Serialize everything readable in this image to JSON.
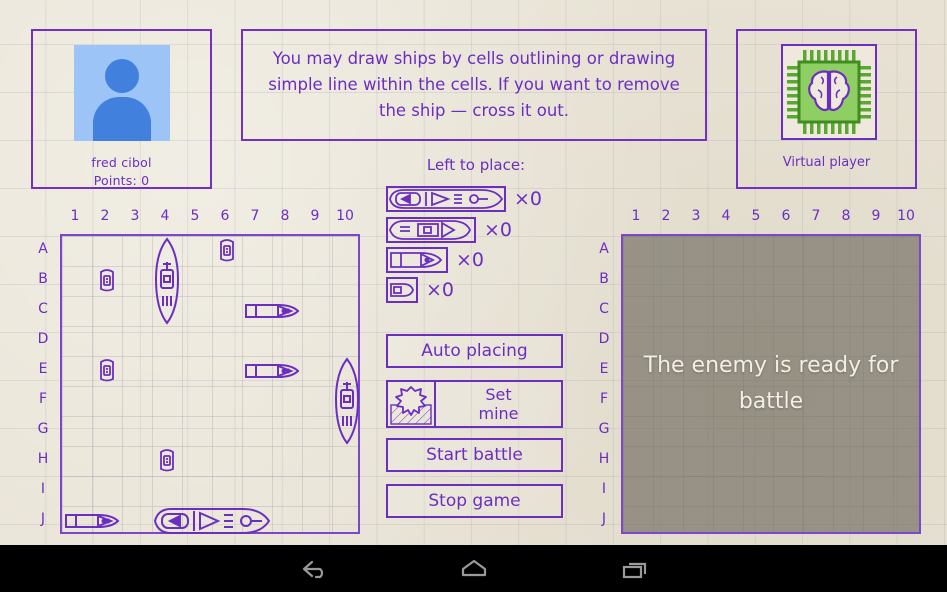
{
  "player": {
    "name": "fred cibol",
    "points_label": "Points: 0",
    "avatar_icon": "person-avatar-icon",
    "avatar_bg": "#9cc4f7",
    "avatar_fg": "#4180dd"
  },
  "instruction": {
    "text": "You may draw ships by cells outlining or drawing simple line within the cells. If you want to remove the ship — cross it out."
  },
  "opponent": {
    "label": "Virtual player",
    "avatar_icon": "cpu-brain-icon",
    "chip_color": "#5aa832",
    "brain_color": "#6b2fc0"
  },
  "theme": {
    "ink": "#6b2fc0",
    "ink_light": "#7d47c9",
    "paper": "#e9e4d6",
    "overlay": "rgba(105,100,88,0.62)",
    "overlay_text": "#f2efe6"
  },
  "fleet": {
    "title": "Left to place:",
    "rows": [
      {
        "size": 4,
        "count_label": "×0",
        "count": 0,
        "icon": "ship-4-icon"
      },
      {
        "size": 3,
        "count_label": "×0",
        "count": 0,
        "icon": "ship-3-icon"
      },
      {
        "size": 2,
        "count_label": "×0",
        "count": 0,
        "icon": "ship-2-icon"
      },
      {
        "size": 1,
        "count_label": "×0",
        "count": 0,
        "icon": "ship-1-icon"
      }
    ]
  },
  "buttons": {
    "auto_placing": "Auto placing",
    "set_mine": "Set\nmine",
    "set_mine_line1": "Set",
    "set_mine_line2": "mine",
    "start_battle": "Start battle",
    "stop_game": "Stop game"
  },
  "boards": {
    "col_labels": [
      "1",
      "2",
      "3",
      "4",
      "5",
      "6",
      "7",
      "8",
      "9",
      "10"
    ],
    "row_labels": [
      "A",
      "B",
      "C",
      "D",
      "E",
      "F",
      "G",
      "H",
      "I",
      "J"
    ],
    "player": {
      "title": "player-board",
      "ships": [
        {
          "size": 3,
          "orientation": "vertical",
          "col": 4,
          "row": "A",
          "cells": [
            "A4",
            "B4",
            "C4"
          ]
        },
        {
          "size": 1,
          "orientation": "single",
          "col": 6,
          "row": "A",
          "cells": [
            "A6"
          ]
        },
        {
          "size": 1,
          "orientation": "single",
          "col": 2,
          "row": "B",
          "cells": [
            "B2"
          ]
        },
        {
          "size": 2,
          "orientation": "horizontal",
          "col": 7,
          "row": "C",
          "cells": [
            "C7",
            "C8"
          ]
        },
        {
          "size": 1,
          "orientation": "single",
          "col": 2,
          "row": "E",
          "cells": [
            "E2"
          ]
        },
        {
          "size": 2,
          "orientation": "horizontal",
          "col": 7,
          "row": "E",
          "cells": [
            "E7",
            "E8"
          ]
        },
        {
          "size": 3,
          "orientation": "vertical",
          "col": 10,
          "row": "E",
          "cells": [
            "E10",
            "F10",
            "G10"
          ]
        },
        {
          "size": 1,
          "orientation": "single",
          "col": 4,
          "row": "H",
          "cells": [
            "H4"
          ]
        },
        {
          "size": 2,
          "orientation": "horizontal",
          "col": 1,
          "row": "J",
          "cells": [
            "J1",
            "J2"
          ]
        },
        {
          "size": 4,
          "orientation": "horizontal",
          "col": 4,
          "row": "J",
          "cells": [
            "J4",
            "J5",
            "J6",
            "J7"
          ]
        }
      ]
    },
    "enemy": {
      "title": "enemy-board",
      "overlay_text": "The enemy is ready for battle",
      "covered": true
    }
  },
  "navbar": {
    "back": "back-icon",
    "home": "home-icon",
    "recents": "recents-icon"
  }
}
